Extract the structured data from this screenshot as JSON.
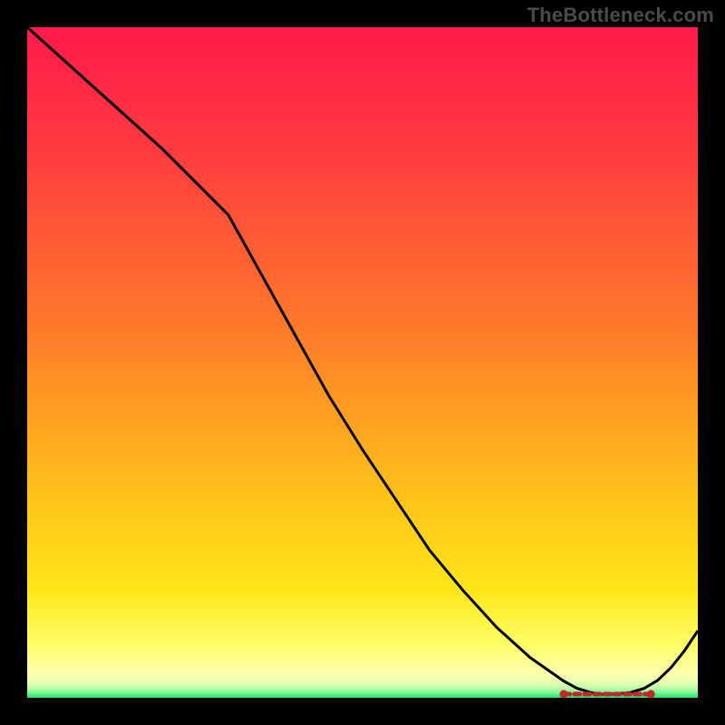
{
  "watermark": "TheBottleneck.com",
  "gradient": {
    "c0": "#ff1a4b",
    "c1": "#ff3a3f",
    "c2": "#ff7a2a",
    "c3": "#ffc21a",
    "c4": "#ffe619",
    "c5": "#ffff66",
    "c6": "#ffffb0",
    "c7": "#d6ffb0",
    "c8": "#8cf79a",
    "c9": "#1ee06a"
  },
  "chart_data": {
    "type": "line",
    "title": "",
    "xlabel": "",
    "ylabel": "",
    "xlim": [
      0,
      100
    ],
    "ylim": [
      0,
      100
    ],
    "x": [
      0,
      5,
      10,
      15,
      20,
      25,
      30,
      35,
      40,
      45,
      50,
      55,
      60,
      65,
      70,
      75,
      80,
      82,
      84,
      86,
      88,
      90,
      92,
      94,
      96,
      98,
      100
    ],
    "y": [
      100,
      95.5,
      91,
      86.5,
      82,
      77,
      72,
      63,
      54,
      45,
      37,
      29.5,
      22,
      16,
      10.5,
      6,
      2.5,
      1.4,
      0.8,
      0.5,
      0.6,
      0.8,
      1.4,
      2.6,
      4.5,
      7,
      10
    ],
    "optimal_range_x": [
      80,
      93
    ],
    "optimal_dash_x": [
      80.5,
      82,
      83.5,
      85,
      86.5,
      88,
      89.5,
      91,
      92.5
    ],
    "annotations": []
  }
}
